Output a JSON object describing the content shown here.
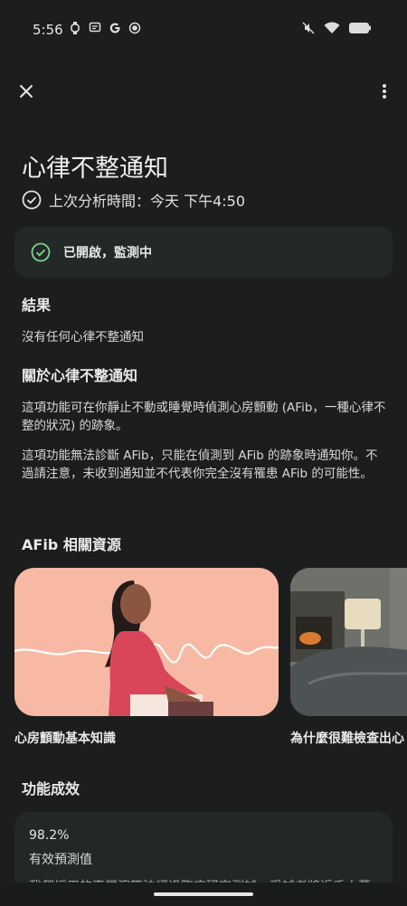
{
  "status_bar": {
    "time": "5:56",
    "left_icons": [
      "watch-icon",
      "message-icon",
      "google-icon",
      "record-icon"
    ],
    "right_icons": [
      "mute-icon",
      "wifi-icon",
      "battery-icon"
    ]
  },
  "header": {
    "title": "心律不整通知",
    "last_analysis": "上次分析時間：今天 下午4:50"
  },
  "status_card": {
    "label": "已開啟，監測中",
    "accent": "#7fd58e"
  },
  "results": {
    "heading": "結果",
    "text": "沒有任何心律不整通知"
  },
  "about": {
    "heading": "關於心律不整通知",
    "paragraph1": "這項功能可在你靜止不動或睡覺時偵測心房顫動 (AFib，一種心律不整的狀況) 的跡象。",
    "paragraph2": "這項功能無法診斷 AFib，只能在偵測到 AFib 的跡象時通知你。不過請注意，未收到通知並不代表你完全沒有罹患 AFib 的可能性。"
  },
  "resources": {
    "heading": "AFib 相關資源",
    "cards": [
      {
        "caption": "心房顫動基本知識"
      },
      {
        "caption": "為什麼很難檢查出心"
      }
    ]
  },
  "performance": {
    "heading": "功能成效",
    "value": "98.2%",
    "label": "有效預測值",
    "description": "我們採用的專屬演算法經過臨床研究測試，受試者將近千人幕"
  }
}
